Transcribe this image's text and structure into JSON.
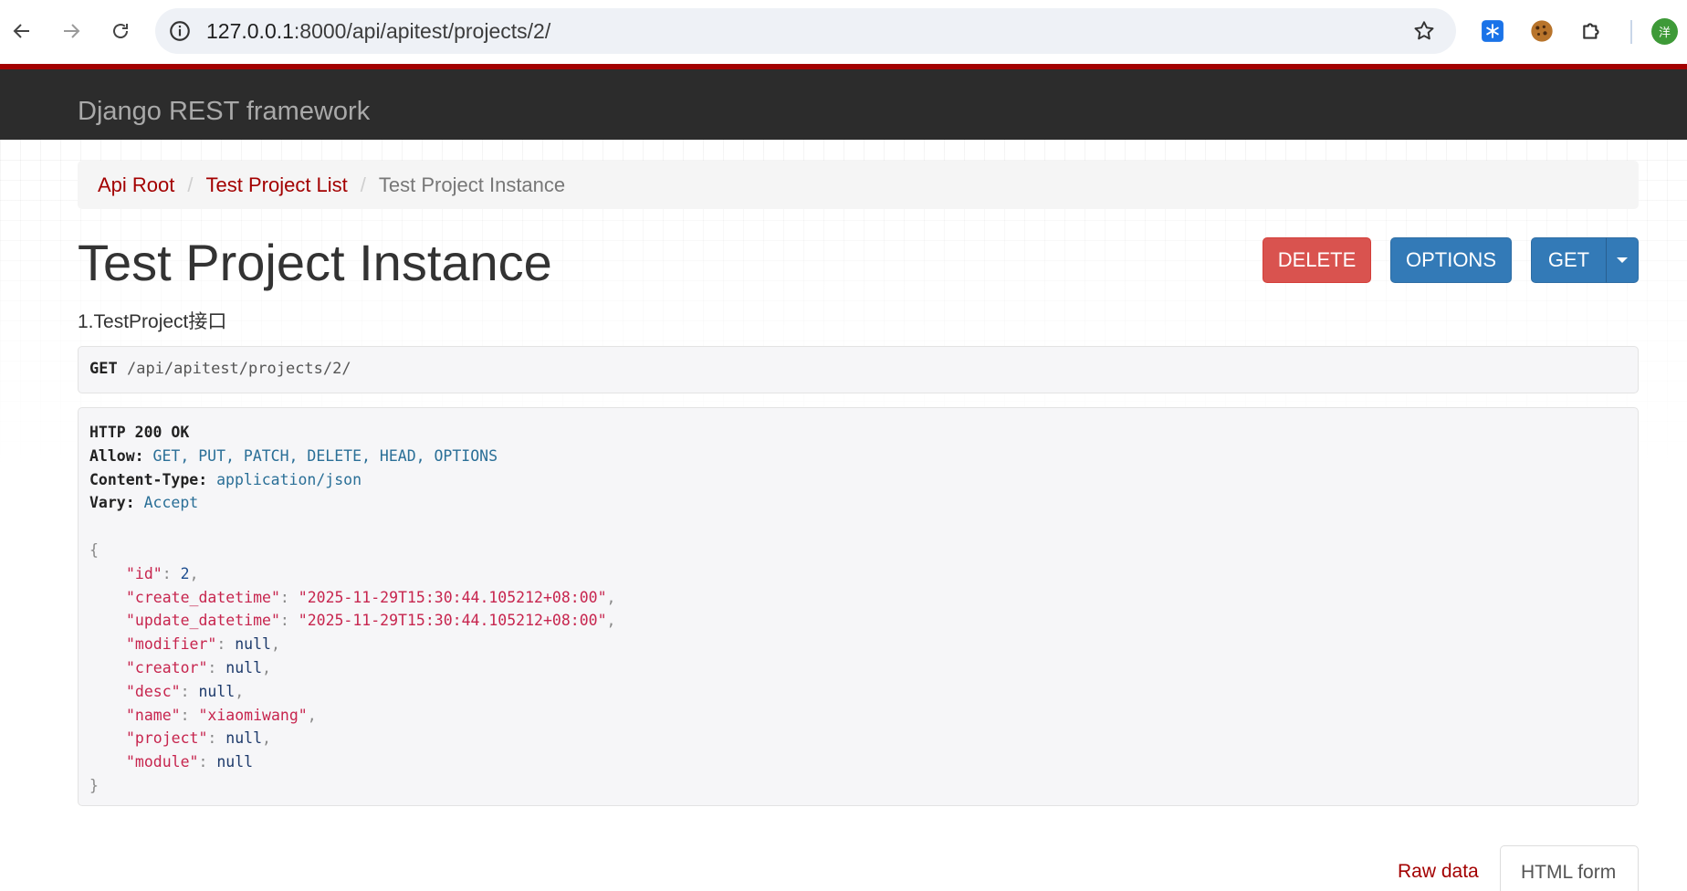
{
  "browser": {
    "url_host": "127.0.0.1",
    "url_rest": ":8000/api/apitest/projects/2/",
    "avatar_label": "洋",
    "icons": [
      "back-icon",
      "forward-icon",
      "reload-icon",
      "info-icon",
      "star-icon",
      "extension-snowflake-icon",
      "cookie-icon",
      "puzzle-icon"
    ]
  },
  "navbar": {
    "brand": "Django REST framework"
  },
  "breadcrumb": {
    "items": [
      "Api Root",
      "Test Project List"
    ],
    "active": "Test Project Instance"
  },
  "page": {
    "title": "Test Project Instance",
    "description": "1.TestProject接口"
  },
  "actions": {
    "delete": "DELETE",
    "options": "OPTIONS",
    "get": "GET"
  },
  "request": {
    "method": "GET",
    "path": "/api/apitest/projects/2/"
  },
  "response": {
    "status": "HTTP 200 OK",
    "headers": [
      {
        "name": "Allow:",
        "value": "GET, PUT, PATCH, DELETE, HEAD, OPTIONS"
      },
      {
        "name": "Content-Type:",
        "value": "application/json"
      },
      {
        "name": "Vary:",
        "value": "Accept"
      }
    ],
    "body": [
      {
        "key": "\"id\"",
        "value": "2",
        "type": "num",
        "comma": ","
      },
      {
        "key": "\"create_datetime\"",
        "value": "\"2025-11-29T15:30:44.105212+08:00\"",
        "type": "str",
        "comma": ","
      },
      {
        "key": "\"update_datetime\"",
        "value": "\"2025-11-29T15:30:44.105212+08:00\"",
        "type": "str",
        "comma": ","
      },
      {
        "key": "\"modifier\"",
        "value": "null",
        "type": "nul",
        "comma": ","
      },
      {
        "key": "\"creator\"",
        "value": "null",
        "type": "nul",
        "comma": ","
      },
      {
        "key": "\"desc\"",
        "value": "null",
        "type": "nul",
        "comma": ","
      },
      {
        "key": "\"name\"",
        "value": "\"xiaomiwang\"",
        "type": "str",
        "comma": ","
      },
      {
        "key": "\"project\"",
        "value": "null",
        "type": "nul",
        "comma": ","
      },
      {
        "key": "\"module\"",
        "value": "null",
        "type": "nul",
        "comma": ""
      }
    ]
  },
  "tabs": {
    "raw": "Raw data",
    "html": "HTML form"
  }
}
